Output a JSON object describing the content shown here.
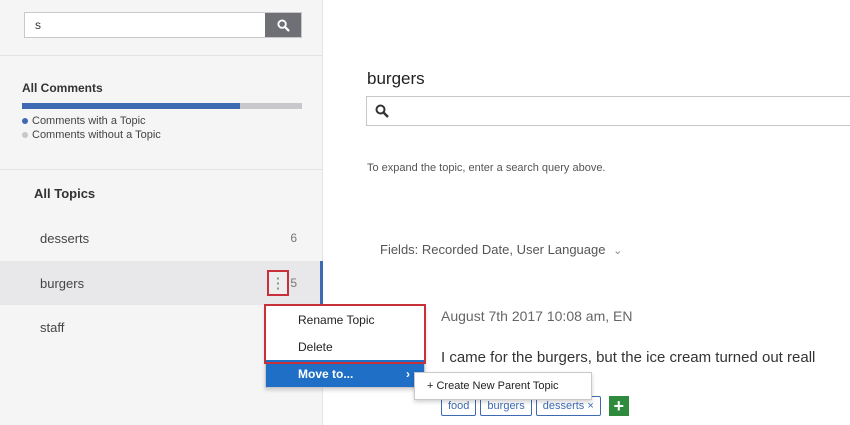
{
  "sidebar": {
    "search": {
      "value": "s"
    },
    "all_comments_label": "All Comments",
    "comments_with_topic_fraction": 0.78,
    "legend": [
      {
        "label": "Comments with a Topic",
        "color": "#3d6ab3"
      },
      {
        "label": "Comments without a Topic",
        "color": "#c8c8cc"
      }
    ],
    "all_topics_label": "All Topics",
    "topics": [
      {
        "name": "desserts",
        "count": "6"
      },
      {
        "name": "burgers",
        "count": "5"
      },
      {
        "name": "staff",
        "count": ""
      }
    ],
    "kebab_glyph": "⋮"
  },
  "context_menu": {
    "rename": "Rename Topic",
    "delete": "Delete",
    "move_to": "Move to...",
    "move_arrow": "›",
    "submenu_item": "+ Create New Parent Topic"
  },
  "main": {
    "title": "burgers",
    "hint": "To expand the topic, enter a search query above.",
    "fields_label": "Fields: Recorded Date, User Language",
    "fields_caret": "⌄",
    "comment": {
      "date": "August 7th 2017 10:08 am, EN",
      "text": "I came for the burgers, but the ice cream turned out reall",
      "tags": [
        "food",
        "burgers",
        "desserts ×"
      ],
      "add_tag": "+"
    }
  },
  "colors": {
    "accent": "#3d6ab3",
    "highlight": "#c8303a",
    "menu_active": "#1f6fc6",
    "add_green": "#2e8b3e"
  }
}
